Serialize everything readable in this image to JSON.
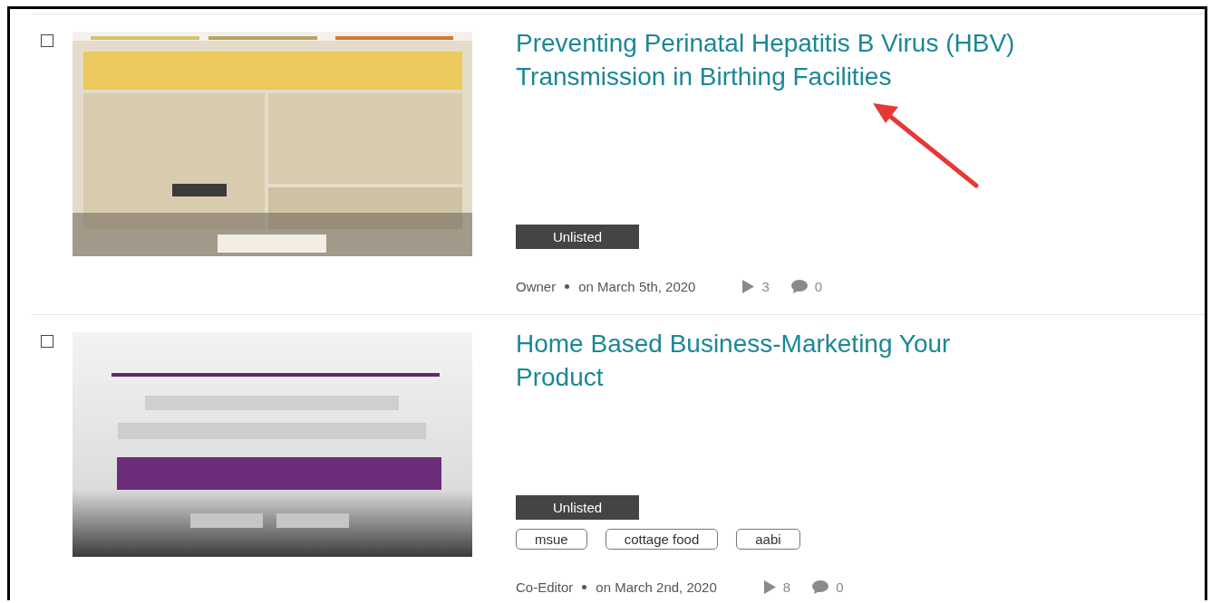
{
  "videos": [
    {
      "selected": false,
      "title": "Preventing Perinatal Hepatitis B Virus (HBV) Transmission in Birthing Facilities",
      "status": "Unlisted",
      "role": "Owner",
      "date": "on March 5th, 2020",
      "plays": "3",
      "comments": "0"
    },
    {
      "selected": false,
      "title": "Home Based Business-Marketing Your Product",
      "status": "Unlisted",
      "tags": [
        "msue",
        "cottage food",
        "aabi"
      ],
      "role": "Co-Editor",
      "date": "on March 2nd, 2020",
      "plays": "8",
      "comments": "0"
    }
  ]
}
